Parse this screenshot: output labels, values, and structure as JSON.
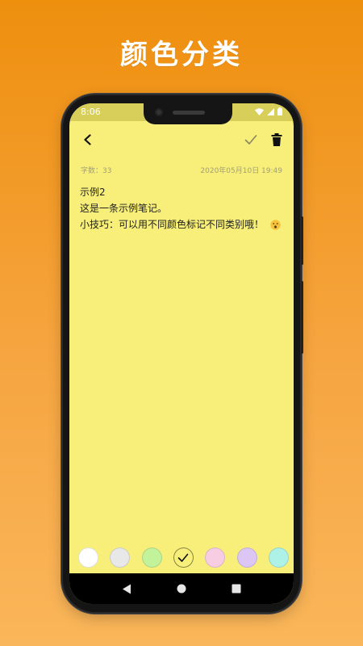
{
  "promo": {
    "title": "颜色分类"
  },
  "status": {
    "time": "8:06"
  },
  "toolbar": {
    "back_icon": "chevron-left-icon",
    "confirm_icon": "check-icon",
    "delete_icon": "trash-icon"
  },
  "meta": {
    "word_count": "字数：33",
    "datetime": "2020年05月10日 19:49"
  },
  "note": {
    "lines": [
      "示例2",
      "这是一条示例笔记。",
      "小技巧：可以用不同颜色标记不同类别哦！"
    ],
    "emoji": "😮"
  },
  "colors": {
    "note_background": "#f7ef7a",
    "swatches": [
      "#ffffff",
      "#e8e8e8",
      "#c2f29a",
      "#f7ef7a",
      "#f7cde3",
      "#dcc6f4",
      "#aef2e7"
    ],
    "selected_index": 3
  },
  "nav": {
    "back_icon": "nav-back-icon",
    "home_icon": "nav-home-icon",
    "recents_icon": "nav-recents-icon"
  }
}
